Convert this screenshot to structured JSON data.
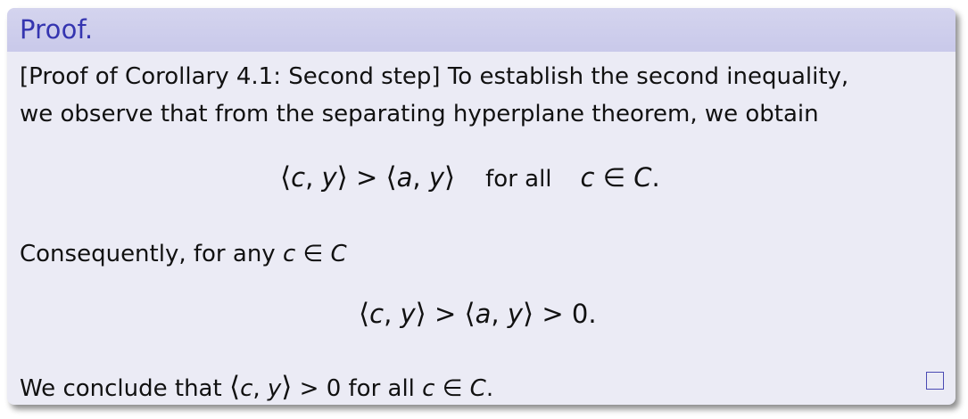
{
  "block": {
    "title": "Proof.",
    "intro_line1": "[Proof of Corollary 4.1: Second step] To establish the second inequality,",
    "intro_line2": "we observe that from the separating hyperplane theorem, we obtain",
    "equation1": {
      "lhs_open": "⟨",
      "c": "c",
      "comma": ", ",
      "y": "y",
      "lhs_close": "⟩",
      "gt": " > ",
      "rhs_open": "⟨",
      "a": "a",
      "rhs_comma": ", ",
      "rhs_y": "y",
      "rhs_close": "⟩",
      "forall_text": "for all",
      "c2": "c",
      "in": " ∈ ",
      "C": "C",
      "period": "."
    },
    "consequently_text": "Consequently, for any ",
    "consequently_c": "c",
    "consequently_in": " ∈ ",
    "consequently_C": "C",
    "equation2": {
      "open1": "⟨",
      "c": "c",
      "comma1": ", ",
      "y1": "y",
      "close1": "⟩",
      "gt1": " > ",
      "open2": "⟨",
      "a": "a",
      "comma2": ", ",
      "y2": "y",
      "close2": "⟩",
      "gt2": " > 0."
    },
    "conclusion_prefix": "We conclude that ",
    "conclusion_open": "⟨",
    "conclusion_c": "c",
    "conclusion_comma": ", ",
    "conclusion_y": "y",
    "conclusion_close": "⟩",
    "conclusion_gt": " > 0 for all ",
    "conclusion_c2": "c",
    "conclusion_in": " ∈ ",
    "conclusion_C": "C",
    "conclusion_period": "."
  },
  "colors": {
    "title": "#3535b0",
    "header_bg": "#cdcdeb",
    "body_bg": "#ebebf5",
    "qed_border": "#4a4ab3"
  }
}
